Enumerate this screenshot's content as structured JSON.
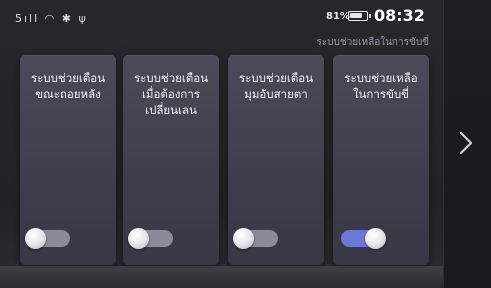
{
  "status_bar": {
    "icons": [
      "signal-icon",
      "wifi-hotspot-icon",
      "bluetooth-icon",
      "usb-icon"
    ],
    "icons_text": "5ıll ◠ ✱ ψ",
    "battery_percent": "81%",
    "battery_level": 0.81,
    "time": "08:32"
  },
  "page": {
    "subtitle": "ระบบช่วยเหลือในการขับขี่"
  },
  "cards": [
    {
      "title": "ระบบช่วยเตือน\nขณะถอยหลัง",
      "toggle_on": false
    },
    {
      "title": "ระบบช่วยเตือน\nเมื่อต้องการ\nเปลี่ยนเลน",
      "toggle_on": false
    },
    {
      "title": "ระบบช่วยเตือน\nมุมอับสายตา",
      "toggle_on": false
    },
    {
      "title": "ระบบช่วยเหลือ\nในการขับขี่",
      "toggle_on": true
    }
  ],
  "nav": {
    "next_icon": "chevron-right-icon"
  },
  "colors": {
    "toggle_on": "#6b78d6",
    "toggle_off": "#8a8a99",
    "card": "#444452"
  }
}
